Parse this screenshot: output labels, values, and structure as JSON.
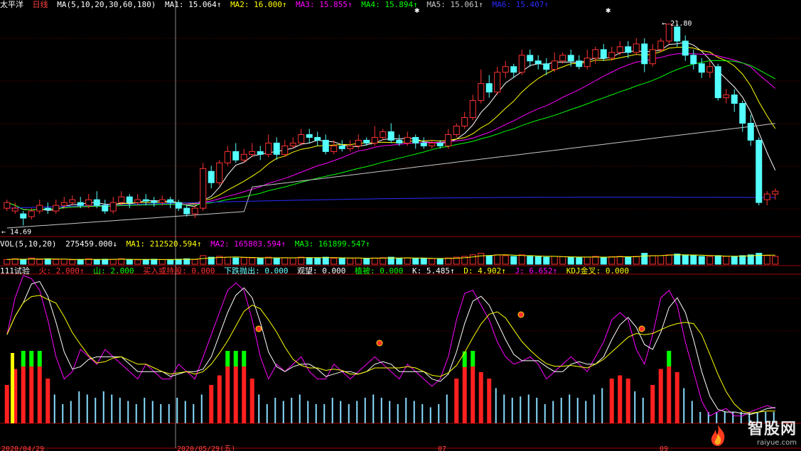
{
  "header_main": {
    "name": "太平洋",
    "period": "日线",
    "ma_spec": "MA(5,10,20,30,60,180)",
    "items": [
      {
        "label": "MA1: 15.064↑",
        "color": "#ffffff"
      },
      {
        "label": "MA2: 16.000↑",
        "color": "#ffff00"
      },
      {
        "label": "MA3: 15.855↑",
        "color": "#ff00ff"
      },
      {
        "label": "MA4: 15.894↑",
        "color": "#00ff00"
      },
      {
        "label": "MA5: 15.061↑",
        "color": "#c8c8c8"
      },
      {
        "label": "MA6: 15.407↑",
        "color": "#2b2bff"
      }
    ]
  },
  "header_vol": {
    "spec": "VOL(5,10,20)",
    "items": [
      {
        "label": "275459.000↓",
        "color": "#ffffff"
      },
      {
        "label": "MA1: 212520.594↑",
        "color": "#ffff00"
      },
      {
        "label": "MA2: 165803.594↑",
        "color": "#ff00ff"
      },
      {
        "label": "MA3: 161899.547↑",
        "color": "#00ff00"
      }
    ]
  },
  "header_ind": {
    "spec": "111试验",
    "items": [
      {
        "label": "火: 2.000↑",
        "color": "#ff3030"
      },
      {
        "label": "山: 2.000",
        "color": "#00ff00"
      },
      {
        "label": "买入或持股: 0.000",
        "color": "#ff3030"
      },
      {
        "label": "下跌抛出: 0.000",
        "color": "#66ffff"
      },
      {
        "label": "观望: 0.000",
        "color": "#ffffff"
      },
      {
        "label": "植被: 0.000",
        "color": "#00ff00"
      },
      {
        "label": "K: 5.485↑",
        "color": "#ffffff"
      },
      {
        "label": "D: 4.902↑",
        "color": "#ffff00"
      },
      {
        "label": "J: 6.652↑",
        "color": "#ff00ff"
      },
      {
        "label": "KDJ金叉: 0.000",
        "color": "#ffff00"
      }
    ]
  },
  "annotations": {
    "high_label": "21.80",
    "low_label": "14.69"
  },
  "colors": {
    "up": "#ff3232",
    "down": "#54ffff",
    "grid": "#7a0000",
    "frame": "#a00000"
  },
  "watermark": {
    "name": "智股网",
    "url": "raiyue.com"
  },
  "chart_data": {
    "type": "candlestick",
    "price_range": [
      14.3,
      22.3
    ],
    "high": 21.8,
    "low": 14.69,
    "ohlc": [
      [
        15.3,
        15.5,
        15.6,
        15.2
      ],
      [
        15.2,
        15.3,
        15.5,
        15.1
      ],
      [
        15.1,
        14.95,
        15.2,
        14.69
      ],
      [
        15.0,
        15.2,
        15.3,
        14.9
      ],
      [
        15.2,
        15.4,
        15.6,
        15.1
      ],
      [
        15.3,
        15.25,
        15.5,
        15.1
      ],
      [
        15.2,
        15.4,
        15.6,
        15.1
      ],
      [
        15.4,
        15.5,
        15.7,
        15.3
      ],
      [
        15.5,
        15.6,
        15.75,
        15.4
      ],
      [
        15.5,
        15.4,
        15.7,
        15.3
      ],
      [
        15.4,
        15.6,
        15.8,
        15.3
      ],
      [
        15.6,
        15.4,
        15.9,
        15.3
      ],
      [
        15.4,
        15.2,
        15.6,
        15.1
      ],
      [
        15.2,
        15.5,
        15.7,
        15.1
      ],
      [
        15.5,
        15.7,
        15.9,
        15.4
      ],
      [
        15.7,
        15.5,
        15.8,
        15.3
      ],
      [
        15.5,
        15.6,
        15.8,
        15.4
      ],
      [
        15.6,
        15.55,
        15.8,
        15.4
      ],
      [
        15.55,
        15.5,
        15.7,
        15.35
      ],
      [
        15.5,
        15.6,
        15.75,
        15.4
      ],
      [
        15.6,
        15.5,
        15.7,
        15.3
      ],
      [
        15.5,
        15.3,
        15.6,
        15.2
      ],
      [
        15.3,
        15.1,
        15.4,
        15.0
      ],
      [
        15.1,
        15.3,
        15.4,
        14.95
      ],
      [
        15.3,
        16.7,
        16.9,
        15.2
      ],
      [
        16.6,
        16.2,
        16.8,
        16.0
      ],
      [
        16.2,
        16.9,
        17.0,
        16.1
      ],
      [
        16.9,
        17.3,
        17.5,
        16.8
      ],
      [
        17.3,
        17.0,
        17.6,
        16.9
      ],
      [
        17.0,
        17.2,
        17.4,
        16.9
      ],
      [
        17.2,
        17.3,
        17.6,
        17.1
      ],
      [
        17.3,
        17.2,
        17.5,
        17.0
      ],
      [
        17.2,
        17.6,
        17.9,
        17.1
      ],
      [
        17.6,
        17.2,
        17.8,
        17.0
      ],
      [
        17.2,
        17.5,
        17.7,
        17.1
      ],
      [
        17.5,
        17.6,
        17.8,
        17.4
      ],
      [
        17.6,
        17.9,
        18.1,
        17.5
      ],
      [
        17.9,
        17.8,
        18.1,
        17.6
      ],
      [
        17.8,
        17.7,
        18.0,
        17.5
      ],
      [
        17.7,
        17.3,
        17.9,
        17.2
      ],
      [
        17.3,
        17.5,
        17.7,
        17.2
      ],
      [
        17.5,
        17.4,
        17.7,
        17.3
      ],
      [
        17.4,
        17.5,
        17.7,
        17.3
      ],
      [
        17.5,
        17.7,
        17.9,
        17.4
      ],
      [
        17.7,
        17.6,
        17.8,
        17.5
      ],
      [
        17.6,
        17.8,
        18.2,
        17.5
      ],
      [
        17.8,
        18.0,
        18.1,
        17.7
      ],
      [
        18.0,
        17.7,
        18.3,
        17.6
      ],
      [
        17.7,
        17.6,
        17.9,
        17.5
      ],
      [
        17.6,
        17.8,
        18.0,
        17.5
      ],
      [
        17.8,
        17.6,
        17.9,
        17.4
      ],
      [
        17.6,
        17.5,
        17.8,
        17.4
      ],
      [
        17.5,
        17.6,
        17.7,
        17.4
      ],
      [
        17.6,
        17.5,
        17.7,
        17.4
      ],
      [
        17.5,
        17.9,
        18.1,
        17.4
      ],
      [
        17.9,
        18.2,
        18.3,
        17.8
      ],
      [
        18.2,
        18.5,
        18.7,
        18.1
      ],
      [
        18.5,
        19.1,
        19.3,
        18.4
      ],
      [
        19.1,
        19.7,
        20.2,
        19.0
      ],
      [
        19.7,
        19.4,
        20.0,
        19.2
      ],
      [
        19.4,
        20.1,
        20.3,
        19.3
      ],
      [
        20.1,
        20.3,
        20.5,
        19.9
      ],
      [
        20.3,
        20.1,
        20.4,
        19.9
      ],
      [
        20.1,
        20.7,
        20.9,
        20.0
      ],
      [
        20.7,
        20.5,
        20.9,
        20.3
      ],
      [
        20.5,
        20.4,
        20.7,
        20.2
      ],
      [
        20.4,
        20.2,
        20.6,
        20.0
      ],
      [
        20.2,
        20.5,
        20.8,
        20.1
      ],
      [
        20.5,
        20.7,
        20.8,
        20.4
      ],
      [
        20.7,
        20.5,
        20.9,
        20.3
      ],
      [
        20.5,
        20.3,
        20.7,
        20.2
      ],
      [
        20.3,
        20.6,
        20.9,
        20.2
      ],
      [
        20.6,
        20.9,
        21.0,
        20.4
      ],
      [
        20.9,
        20.6,
        21.1,
        20.5
      ],
      [
        20.6,
        20.8,
        21.0,
        20.5
      ],
      [
        20.8,
        21.0,
        21.2,
        20.7
      ],
      [
        21.0,
        20.8,
        21.2,
        20.6
      ],
      [
        20.8,
        21.1,
        21.3,
        20.7
      ],
      [
        21.1,
        20.4,
        21.3,
        20.1
      ],
      [
        20.4,
        20.9,
        21.1,
        20.3
      ],
      [
        20.9,
        21.2,
        21.3,
        20.8
      ],
      [
        21.2,
        21.8,
        21.8,
        21.1
      ],
      [
        21.7,
        21.2,
        21.8,
        21.0
      ],
      [
        21.2,
        20.7,
        21.4,
        20.5
      ],
      [
        20.7,
        20.4,
        20.9,
        20.2
      ],
      [
        20.4,
        20.1,
        20.6,
        19.9
      ],
      [
        20.1,
        20.3,
        20.5,
        19.9
      ],
      [
        20.3,
        19.2,
        20.4,
        19.1
      ],
      [
        19.2,
        19.3,
        19.5,
        19.0
      ],
      [
        19.3,
        19.0,
        19.5,
        18.7
      ],
      [
        19.0,
        18.3,
        19.1,
        18.0
      ],
      [
        18.3,
        17.7,
        18.6,
        17.5
      ],
      [
        17.7,
        15.5,
        17.8,
        15.4
      ],
      [
        15.6,
        15.8,
        15.9,
        15.4
      ],
      [
        15.8,
        15.9,
        16.0,
        15.6
      ]
    ],
    "volume": [
      0.3,
      0.35,
      0.3,
      0.4,
      0.3,
      0.35,
      0.3,
      0.32,
      0.28,
      0.3,
      0.35,
      0.3,
      0.32,
      0.3,
      0.35,
      0.3,
      0.28,
      0.3,
      0.32,
      0.3,
      0.3,
      0.32,
      0.35,
      0.3,
      0.55,
      0.45,
      0.5,
      0.45,
      0.4,
      0.42,
      0.4,
      0.38,
      0.45,
      0.4,
      0.42,
      0.4,
      0.45,
      0.42,
      0.4,
      0.45,
      0.38,
      0.4,
      0.38,
      0.4,
      0.36,
      0.4,
      0.42,
      0.45,
      0.38,
      0.4,
      0.36,
      0.38,
      0.35,
      0.36,
      0.4,
      0.45,
      0.5,
      0.6,
      0.7,
      0.55,
      0.6,
      0.55,
      0.5,
      0.6,
      0.5,
      0.48,
      0.45,
      0.5,
      0.48,
      0.45,
      0.42,
      0.45,
      0.5,
      0.45,
      0.48,
      0.5,
      0.45,
      0.5,
      0.7,
      0.55,
      0.55,
      0.6,
      0.65,
      0.6,
      0.55,
      0.5,
      0.5,
      0.55,
      0.5,
      0.5,
      0.55,
      0.6,
      0.7,
      0.55,
      0.5
    ],
    "indicator": {
      "series": [
        {
          "name": "K",
          "color": "#ffffff"
        },
        {
          "name": "D",
          "color": "#ffff00"
        },
        {
          "name": "J",
          "color": "#ff00ff"
        }
      ],
      "j": [
        60,
        85,
        100,
        98,
        90,
        70,
        45,
        30,
        35,
        50,
        45,
        40,
        50,
        45,
        40,
        35,
        30,
        40,
        35,
        30,
        30,
        40,
        35,
        30,
        45,
        60,
        75,
        90,
        95,
        90,
        70,
        45,
        30,
        40,
        35,
        40,
        45,
        35,
        30,
        30,
        40,
        35,
        30,
        35,
        40,
        45,
        40,
        35,
        30,
        40,
        35,
        30,
        25,
        30,
        45,
        70,
        88,
        90,
        80,
        70,
        55,
        45,
        40,
        42,
        45,
        40,
        30,
        35,
        40,
        45,
        40,
        35,
        45,
        55,
        70,
        75,
        70,
        50,
        40,
        60,
        85,
        90,
        80,
        55,
        35,
        15,
        5,
        8,
        10,
        5,
        5,
        8,
        10,
        12,
        10
      ]
    },
    "x_labels": [
      "2020/04/29",
      "2020/05/29(五)",
      "07",
      "09"
    ]
  }
}
